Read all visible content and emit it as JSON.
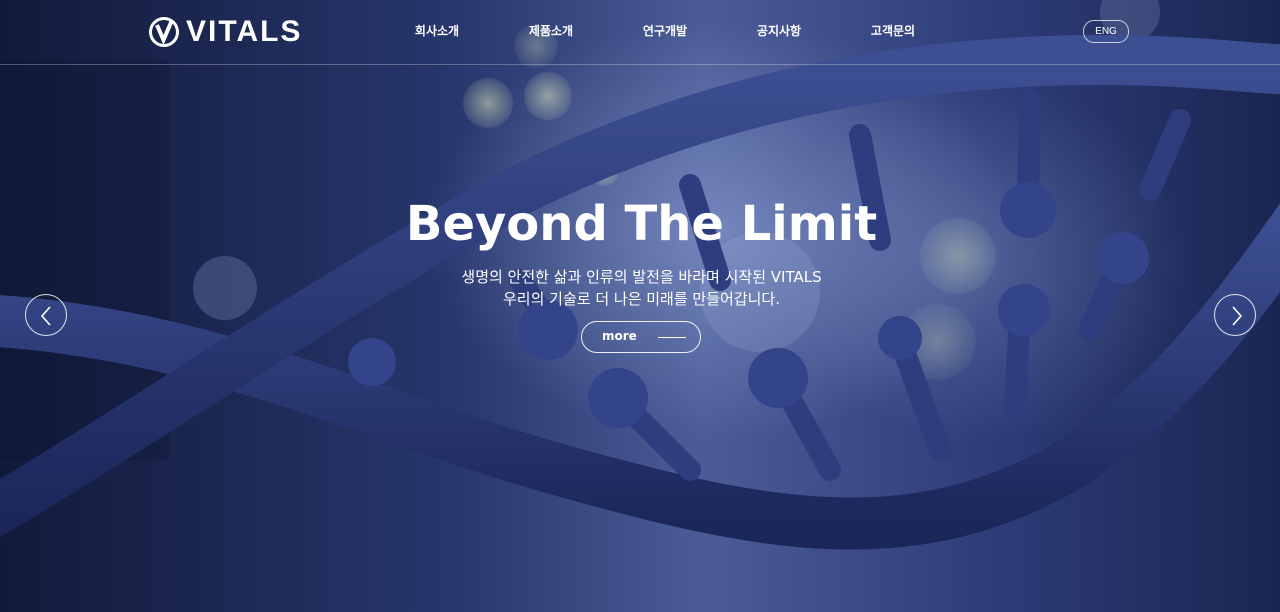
{
  "header": {
    "logo_text": "VITALS",
    "nav": [
      "회사소개",
      "제품소개",
      "연구개발",
      "공지사항",
      "고객문의"
    ],
    "lang_label": "ENG"
  },
  "hero": {
    "headline": "Beyond The Limit",
    "subtitle_line1": "생명의 안전한 삶과 인류의 발전을 바라며 시작된 VITALS",
    "subtitle_line2": "우리의 기술로 더 나은 미래를 만들어갑니다.",
    "more_label": "more"
  },
  "icons": {
    "prev": "chevron-left-icon",
    "next": "chevron-right-icon",
    "logo": "vitals-logo-mark"
  }
}
